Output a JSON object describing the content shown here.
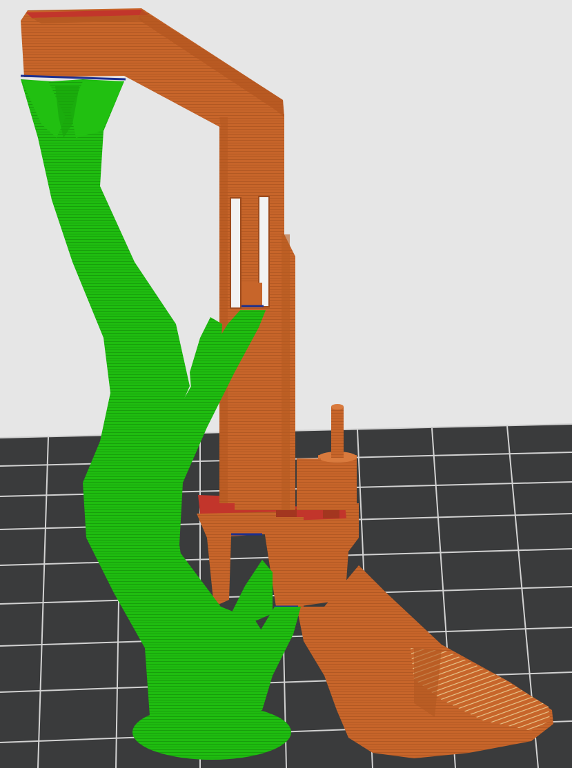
{
  "viewport": {
    "background_color": "#e6e6e6",
    "bed_color": "#3a3b3c",
    "bed_grid_color": "#d2d2d2"
  },
  "model": {
    "part_color": "#c7652a",
    "part_dark_color": "#9e4b1c",
    "top_surface_color": "#c2352b",
    "support_color": "#1fbd10",
    "support_dark_color": "#14870a",
    "interface_color": "#1b2f8f",
    "perimeter_highlight_color": "#f2f2f2"
  }
}
